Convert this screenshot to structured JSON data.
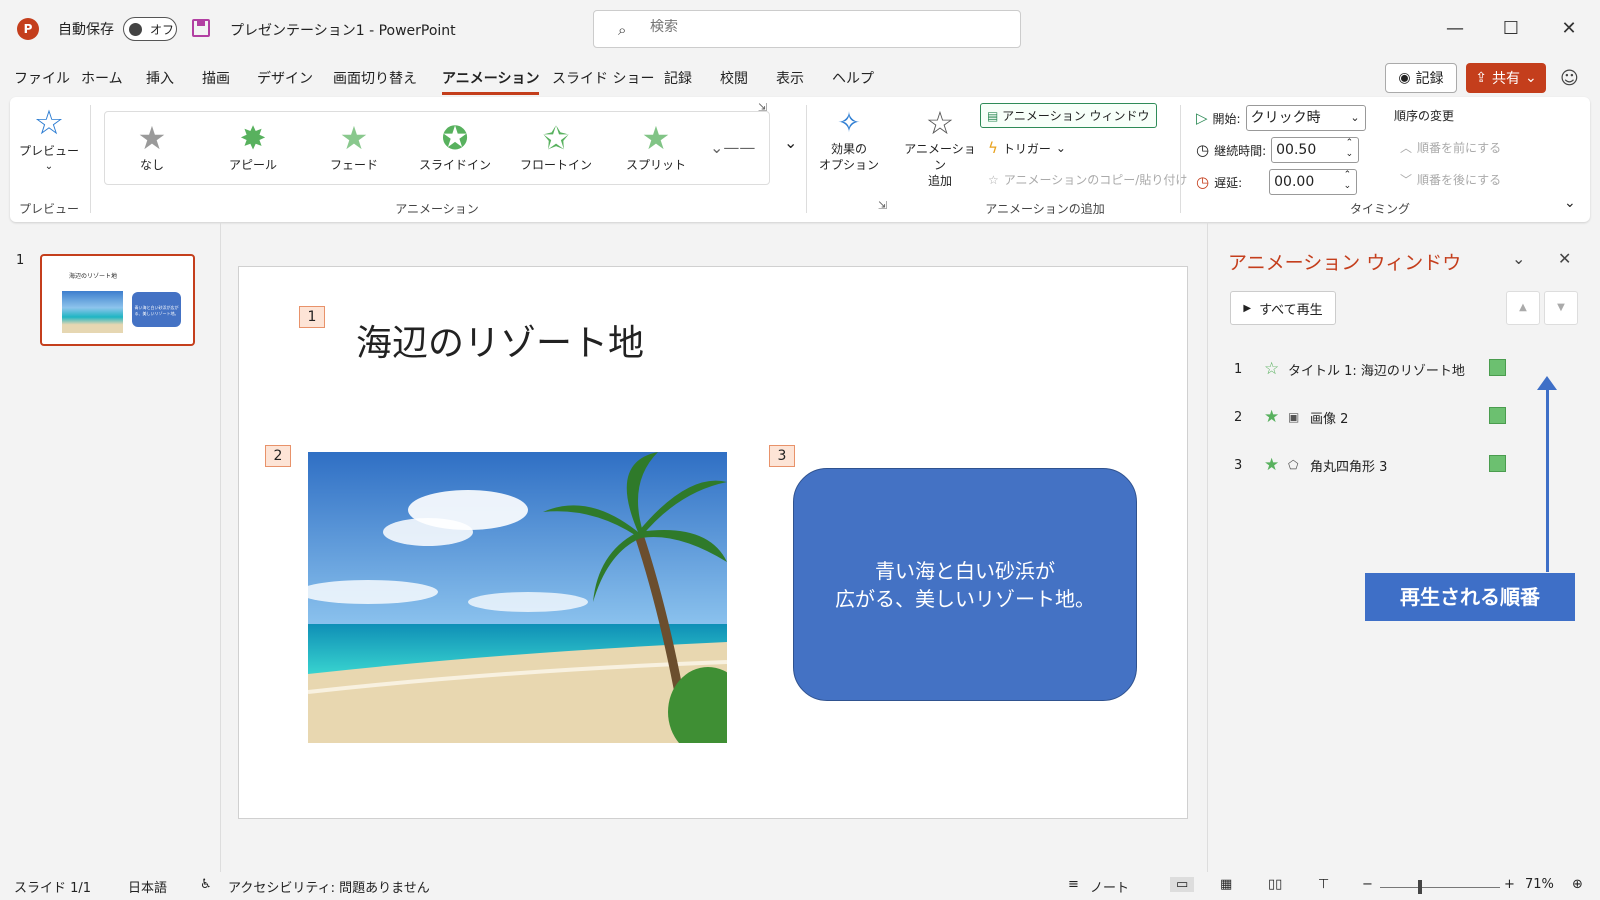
{
  "titlebar": {
    "autosave_label": "自動保存",
    "autosave_state": "オフ",
    "document_title": "プレゼンテーション1  -  PowerPoint",
    "search_placeholder": "検索",
    "app_logo": "P"
  },
  "menu": {
    "tabs": [
      "ファイル",
      "ホーム",
      "挿入",
      "描画",
      "デザイン",
      "画面切り替え",
      "アニメーション",
      "スライド ショー",
      "記録",
      "校閲",
      "表示",
      "ヘルプ"
    ],
    "active_tab": "アニメーション",
    "record_label": "記録",
    "share_label": "共有"
  },
  "ribbon": {
    "preview_label": "プレビュー",
    "preview_group": "プレビュー",
    "animation_group": "アニメーション",
    "gallery": [
      "なし",
      "アピール",
      "フェード",
      "スライドイン",
      "フロートイン",
      "スプリット"
    ],
    "effect_options": "効果の\nオプション",
    "add_animation": "アニメーション\n追加",
    "animation_window": "アニメーション ウィンドウ",
    "trigger": "トリガー",
    "copy_paste": "アニメーションのコピー/貼り付け",
    "add_group": "アニメーションの追加",
    "start_label": "開始:",
    "start_value": "クリック時",
    "duration_label": "継続時間:",
    "duration_value": "00.50",
    "delay_label": "遅延:",
    "delay_value": "00.00",
    "timing_group": "タイミング",
    "reorder_title": "順序の変更",
    "move_earlier": "順番を前にする",
    "move_later": "順番を後にする"
  },
  "thumbnail": {
    "number": "1",
    "title": "海辺のリゾート地",
    "box_text": "青い海と白い砂浜が広がる、美しいリゾート地。"
  },
  "slide": {
    "title": "海辺のリゾート地",
    "tag1": "1",
    "tag2": "2",
    "tag3": "3",
    "box_line1": "青い海と白い砂浜が",
    "box_line2": "広がる、美しいリゾート地。"
  },
  "pane": {
    "title": "アニメーション ウィンドウ",
    "play_all": "すべて再生",
    "items": [
      {
        "num": "1",
        "label": "タイトル 1: 海辺のリゾート地"
      },
      {
        "num": "2",
        "label": "画像 2"
      },
      {
        "num": "3",
        "label": "角丸四角形 3"
      }
    ],
    "callout": "再生される順番"
  },
  "status": {
    "slide": "スライド 1/1",
    "language": "日本語",
    "accessibility": "アクセシビリティ: 問題ありません",
    "notes": "ノート",
    "zoom": "71%"
  },
  "colors": {
    "accent": "#c43e1c",
    "shape_fill": "#4472c4",
    "callout": "#3e6fc7",
    "anim_star": "#58b15e"
  }
}
